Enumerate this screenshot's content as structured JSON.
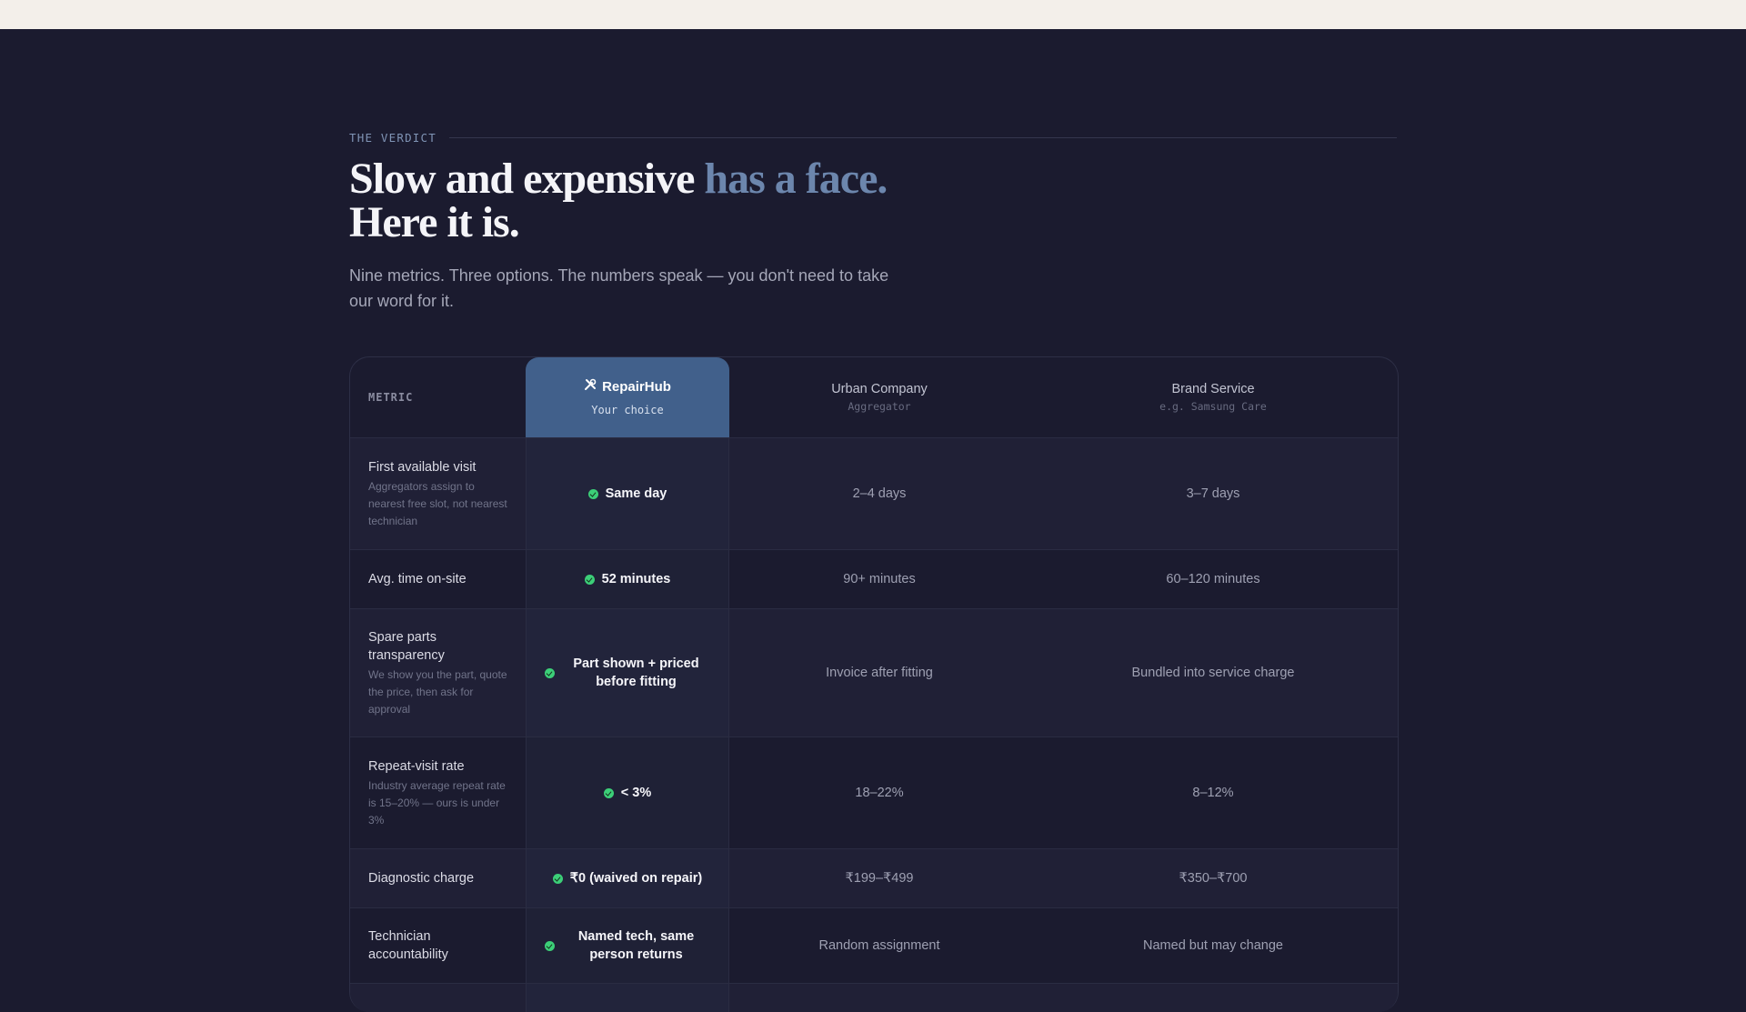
{
  "hero": {
    "eyebrow": "THE VERDICT",
    "title_main": "Slow and expensive",
    "title_accent": "has a face.",
    "title_line2": "Here it is.",
    "lede": "Nine metrics. Three options. The numbers speak — you don't need to take our word for it."
  },
  "table": {
    "metric_header": "METRIC",
    "columns": {
      "hub": {
        "title": "RepairHub",
        "sub": "Your choice",
        "icon": "tools-icon"
      },
      "urban": {
        "title": "Urban Company",
        "sub": "Aggregator"
      },
      "brand": {
        "title": "Brand Service",
        "sub": "e.g. Samsung Care"
      }
    },
    "rows": [
      {
        "metric": "First available visit",
        "note": "Aggregators assign to nearest free slot, not nearest technician",
        "hub": "Same day",
        "urban": "2–4 days",
        "brand": "3–7 days"
      },
      {
        "metric": "Avg. time on-site",
        "note": "",
        "hub": "52 minutes",
        "urban": "90+ minutes",
        "brand": "60–120 minutes"
      },
      {
        "metric": "Spare parts transparency",
        "note": "We show you the part, quote the price, then ask for approval",
        "hub": "Part shown + priced before fitting",
        "urban": "Invoice after fitting",
        "brand": "Bundled into service charge"
      },
      {
        "metric": "Repeat-visit rate",
        "note": "Industry average repeat rate is 15–20% — ours is under 3%",
        "hub": "< 3%",
        "urban": "18–22%",
        "brand": "8–12%"
      },
      {
        "metric": "Diagnostic charge",
        "note": "",
        "hub": "₹0 (waived on repair)",
        "urban": "₹199–₹499",
        "brand": "₹350–₹700"
      },
      {
        "metric": "Technician accountability",
        "note": "",
        "hub": "Named tech, same person returns",
        "urban": "Random assignment",
        "brand": "Named but may change"
      }
    ]
  },
  "colors": {
    "background": "#1b1b2f",
    "accent": "#6c86ad",
    "hub_header": "#41608b",
    "check": "#3ccf78"
  }
}
